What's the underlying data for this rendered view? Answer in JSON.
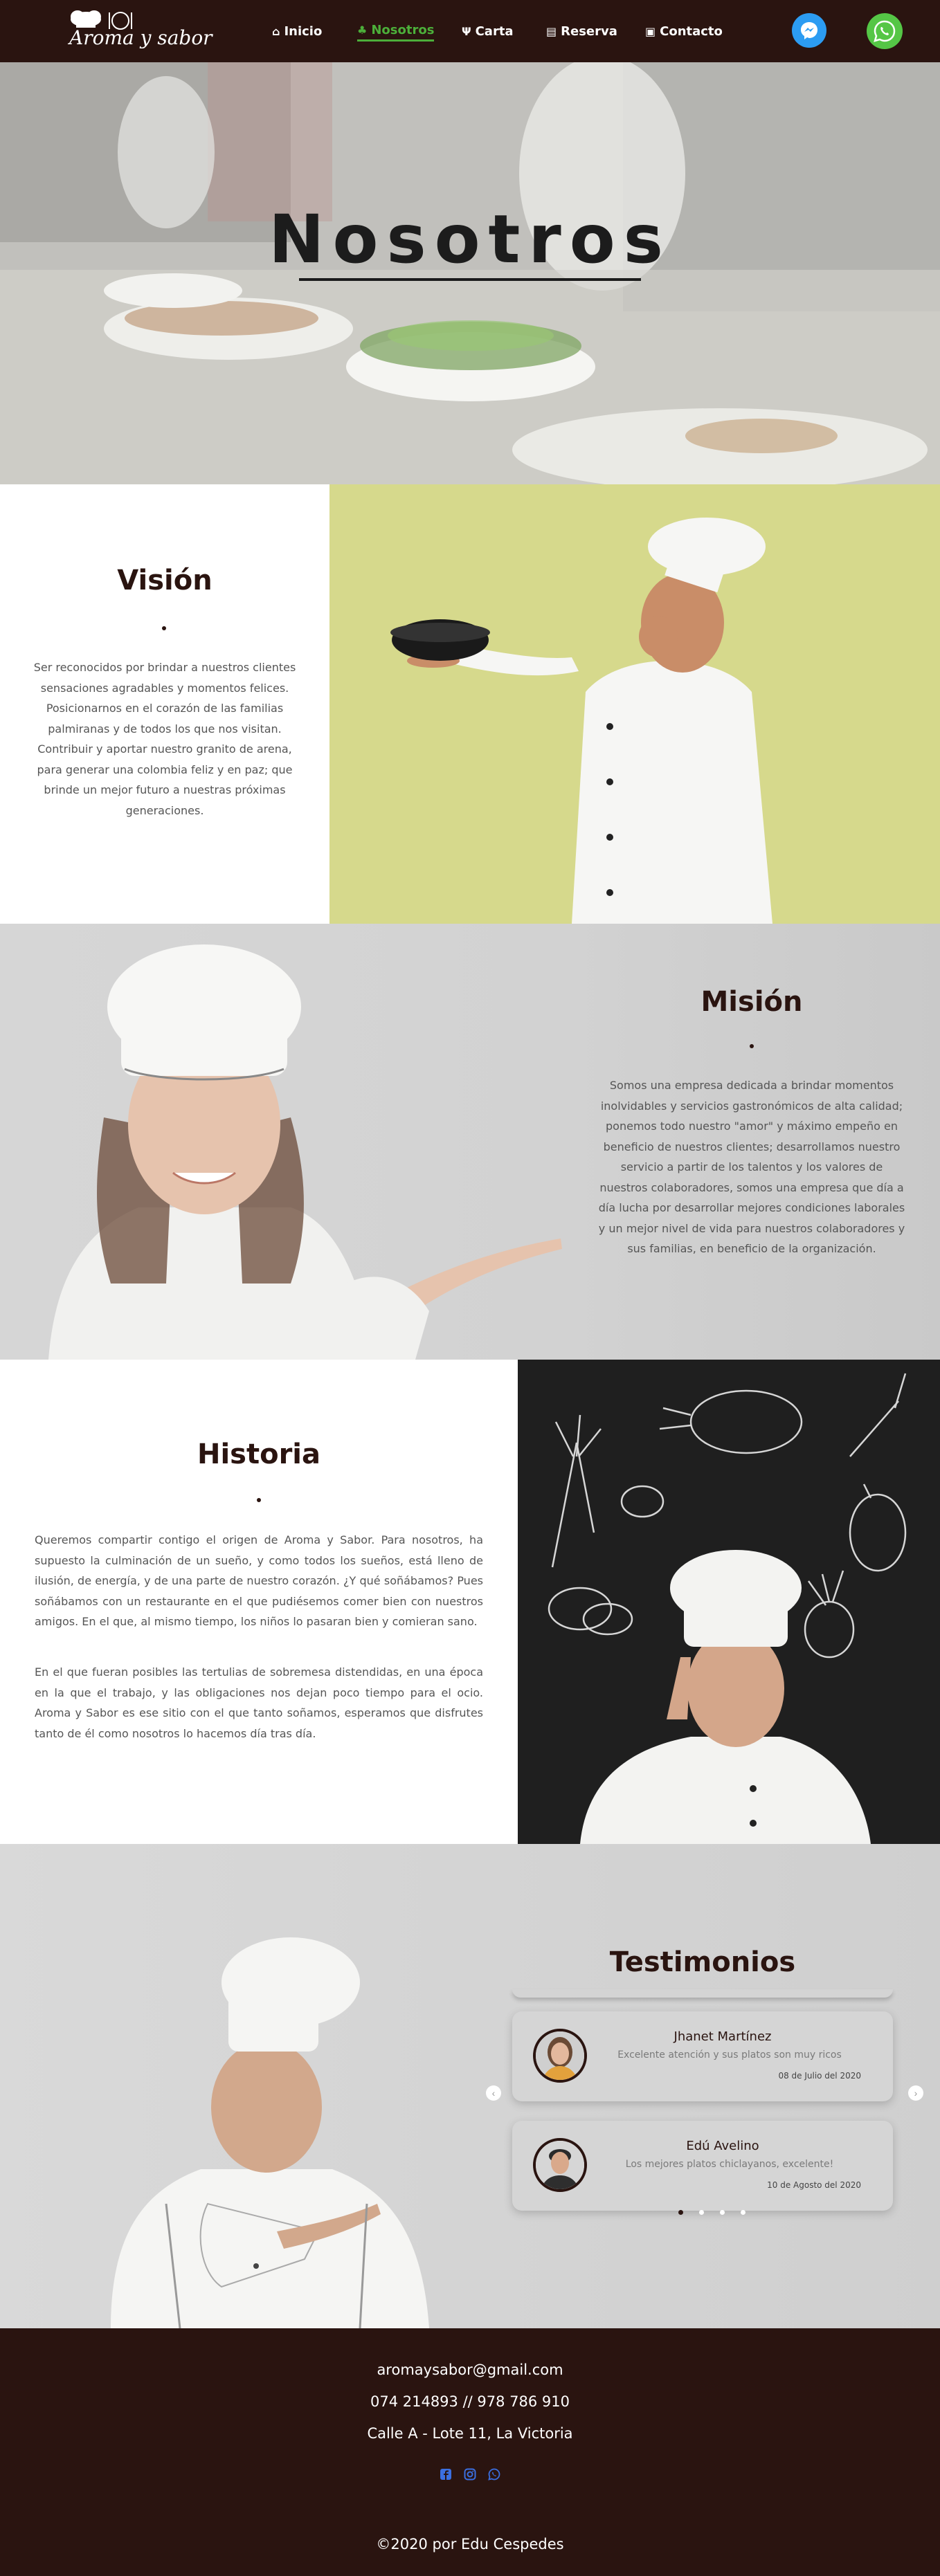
{
  "colors": {
    "brand_dark": "#2a1410",
    "accent_green": "#4caf3a",
    "messenger_blue": "#2c9cf2",
    "whatsapp_green": "#55c646",
    "social_blue": "#3b6fe0"
  },
  "nav": {
    "logo_text": "Aroma y sabor",
    "items": [
      {
        "label": "Inicio",
        "icon": "home-icon"
      },
      {
        "label": "Nosotros",
        "icon": "chef-hat-icon"
      },
      {
        "label": "Carta",
        "icon": "utensils-icon"
      },
      {
        "label": "Reserva",
        "icon": "calendar-icon"
      },
      {
        "label": "Contacto",
        "icon": "contact-icon"
      }
    ],
    "active": "Nosotros",
    "messenger_icon": "messenger-icon",
    "whatsapp_icon": "whatsapp-icon"
  },
  "hero": {
    "title": "Nosotros"
  },
  "vision": {
    "title": "Visión",
    "text": "Ser reconocidos por brindar a nuestros clientes sensaciones agradables y momentos felices. Posicionarnos en el corazón de las familias palmiranas y de todos los que nos visitan. Contribuir y aportar nuestro granito de arena, para generar una colombia feliz y en paz; que brinde un mejor futuro a nuestras próximas generaciones."
  },
  "mision": {
    "title": "Misión",
    "text": "Somos una empresa dedicada a brindar momentos inolvidables y servicios gastronómicos de alta calidad; ponemos todo nuestro \"amor\" y máximo empeño en beneficio de nuestros clientes; desarrollamos nuestro servicio a partir de los talentos y los valores de nuestros colaboradores, somos una empresa que día a día lucha por desarrollar mejores condiciones laborales y un mejor nivel de vida para nuestros colaboradores y sus familias, en beneficio de la organización."
  },
  "historia": {
    "title": "Historia",
    "paragraph_1": "Queremos compartir contigo el origen de Aroma y Sabor. Para nosotros, ha supuesto la culminación de un sueño, y como todos los sueños, está lleno de ilusión, de energía, y de una parte de nuestro corazón. ¿Y qué soñábamos? Pues soñábamos con un restaurante en el que pudiésemos comer bien con nuestros amigos. En el que, al mismo tiempo, los niños lo pasaran bien y comieran sano.",
    "paragraph_2": "En el que fueran posibles las tertulias de sobremesa distendidas, en una época en la que el trabajo, y las obligaciones nos dejan poco tiempo para el ocio. Aroma y Sabor es ese sitio con el que tanto soñamos, esperamos que disfrutes tanto de él como nosotros lo hacemos día tras día."
  },
  "testimonios": {
    "title": "Testimonios",
    "items": [
      {
        "name": "Jhanet Martínez",
        "text": "Excelente atención y sus platos son muy ricos",
        "date": "08 de Julio del 2020"
      },
      {
        "name": "Edú Avelino",
        "text": "Los mejores platos chiclayanos, excelente!",
        "date": "10 de Agosto del 2020"
      }
    ],
    "prev_icon": "chevron-left-icon",
    "next_icon": "chevron-right-icon",
    "active_page": 1,
    "page_count": 4
  },
  "footer": {
    "email": "aromaysabor@gmail.com",
    "phones": "074 214893 // 978 786 910",
    "address": "Calle A - Lote 11, La Victoria",
    "social": [
      "facebook-icon",
      "instagram-icon",
      "whatsapp-icon"
    ],
    "copyright": "©2020 por Edu Cespedes"
  }
}
